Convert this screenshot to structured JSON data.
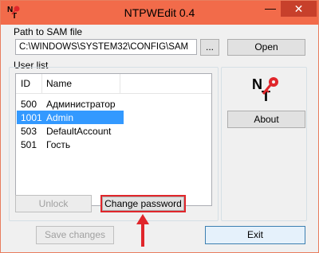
{
  "window": {
    "title": "NTPWEdit 0.4",
    "minimize_glyph": "—",
    "close_glyph": "✕",
    "colors": {
      "titlebar": "#f26b4a",
      "close": "#c7402b",
      "selection": "#3399ff",
      "highlight": "#e0262b"
    }
  },
  "path": {
    "label": "Path to SAM file",
    "value": "C:\\WINDOWS\\SYSTEM32\\CONFIG\\SAM",
    "browse_label": "...",
    "open_label": "Open"
  },
  "users": {
    "group_label": "User list",
    "columns": [
      "ID",
      "Name"
    ],
    "rows": [
      {
        "id": "500",
        "name": "Администратор",
        "selected": false
      },
      {
        "id": "1001",
        "name": "Admin",
        "selected": true
      },
      {
        "id": "503",
        "name": "DefaultAccount",
        "selected": false
      },
      {
        "id": "501",
        "name": "Гость",
        "selected": false
      }
    ],
    "unlock_label": "Unlock",
    "change_password_label": "Change password"
  },
  "side": {
    "logo_icon": "ntpwedit-logo-icon",
    "about_label": "About"
  },
  "footer": {
    "save_label": "Save changes",
    "exit_label": "Exit"
  }
}
